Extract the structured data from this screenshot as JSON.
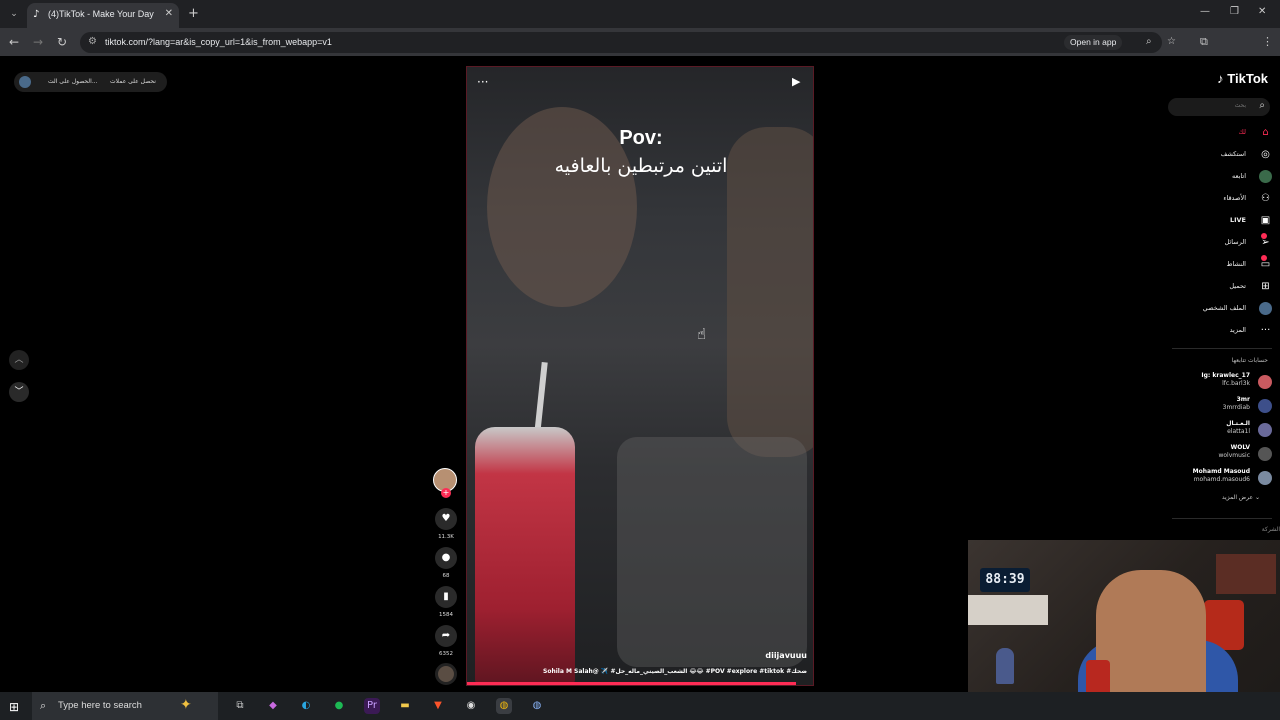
{
  "browser": {
    "tab_title": "(4)TikTok - Make Your Day",
    "url": "tiktok.com/?lang=ar&is_copy_url=1&is_from_webapp=v1",
    "open_in_app": "Open in app"
  },
  "page": {
    "top_pill": {
      "left": "الحصول على الت...",
      "right": "نحصل على عملات"
    },
    "video": {
      "caption_title": "Pov:",
      "caption_arabic": "اتنين مرتبطين بالعافيه",
      "watermark": "diijavuuu",
      "description": "Sohila M Salah@ ✈️ #الشعب_الصيني_ماله_حل 😂😂 #POV #explore #tiktok #ضحك",
      "progress": 0.95
    },
    "actions": {
      "likes": "11.3K",
      "comments": "68",
      "saves": "1584",
      "shares": "6352"
    }
  },
  "sidebar": {
    "logo": "TikTok",
    "search_placeholder": "بحث",
    "nav": [
      {
        "label": "لك",
        "icon": "home-icon",
        "active": true
      },
      {
        "label": "استكشف",
        "icon": "compass-icon"
      },
      {
        "label": "اتابعه",
        "icon": "following-icon"
      },
      {
        "label": "الأصدقاء",
        "icon": "friends-icon"
      },
      {
        "label": "LIVE",
        "icon": "live-icon"
      },
      {
        "label": "الرسائل",
        "icon": "messages-icon"
      },
      {
        "label": "النشاط",
        "icon": "activity-icon"
      },
      {
        "label": "تحميل",
        "icon": "upload-icon"
      },
      {
        "label": "الملف الشخصي",
        "icon": "profile-icon"
      },
      {
        "label": "المزيد",
        "icon": "more-icon"
      }
    ],
    "following_title": "حسابات تتابعها",
    "accounts": [
      {
        "name": "Ig: krawlec_17",
        "handle": "lfc.barl3k"
      },
      {
        "name": "3mr",
        "handle": "3mrrdiab"
      },
      {
        "name": "الـعـتـال",
        "handle": "elatta1l"
      },
      {
        "name": "WOLV",
        "handle": "wolvmusic"
      },
      {
        "name": "Mohamd Masoud",
        "handle": "mohamd.masoud6"
      }
    ],
    "see_more": "عرض المزيد",
    "footer": "الشركة"
  },
  "webcam": {
    "clock": "88:39"
  },
  "taskbar": {
    "search_placeholder": "Type here to search"
  },
  "colors": {
    "accent": "#fe2c55",
    "chrome_bg": "#202124",
    "taskbar": "#1d2023"
  }
}
